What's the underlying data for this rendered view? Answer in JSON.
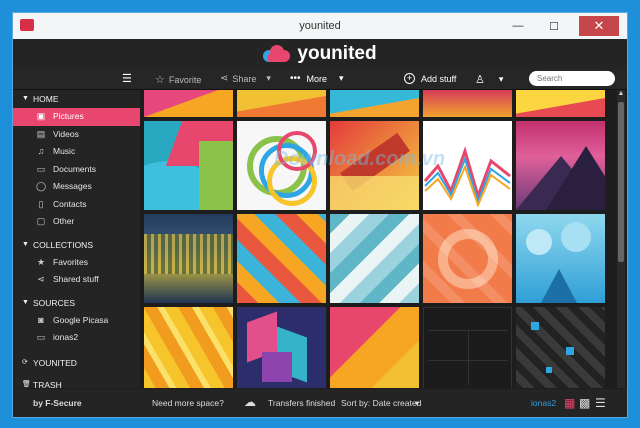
{
  "window": {
    "title": "younited"
  },
  "brand": {
    "name": "younited"
  },
  "toolbar": {
    "favorite": "Favorite",
    "share": "Share",
    "more": "More",
    "add_stuff": "Add stuff",
    "search_placeholder": "Search"
  },
  "sidebar": {
    "home": {
      "label": "HOME",
      "items": [
        "Pictures",
        "Videos",
        "Music",
        "Documents",
        "Messages",
        "Contacts",
        "Other"
      ]
    },
    "collections": {
      "label": "COLLECTIONS",
      "items": [
        "Favorites",
        "Shared stuff"
      ]
    },
    "sources": {
      "label": "SOURCES",
      "items": [
        "Google Picasa",
        "ionas2"
      ]
    },
    "younited": "YOUNITED",
    "trash": "TRASH"
  },
  "status": {
    "brand": "by F-Secure",
    "need_space": "Need more space?",
    "transfers": "Transfers finished",
    "sort": "Sort by: Date created",
    "user": "ionas2"
  },
  "watermark": "Download.com.vn",
  "colors": {
    "accent": "#e8466e",
    "link": "#2f9fe0"
  }
}
